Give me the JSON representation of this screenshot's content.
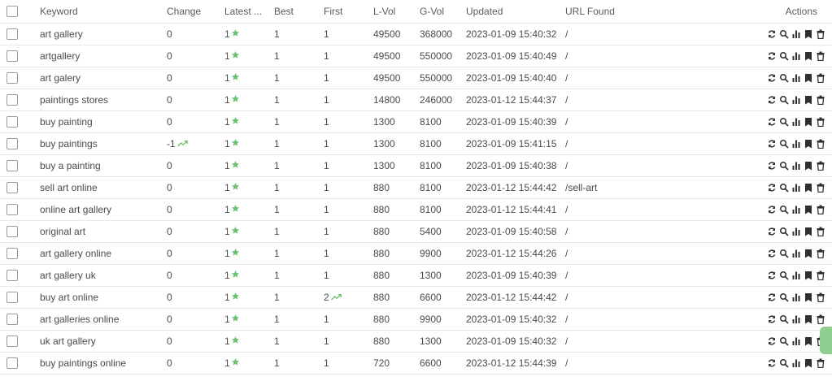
{
  "columns": {
    "keyword": "Keyword",
    "change": "Change",
    "latest": "Latest ...",
    "best": "Best",
    "first": "First",
    "lvol": "L-Vol",
    "gvol": "G-Vol",
    "updated": "Updated",
    "url": "URL Found",
    "actions": "Actions"
  },
  "colors": {
    "accent_green": "#6cc070",
    "icon_dark": "#2f2f2f"
  },
  "action_icons": [
    "refresh-icon",
    "search-icon",
    "bar-chart-icon",
    "bookmark-icon",
    "trash-icon"
  ],
  "rows": [
    {
      "keyword": "art gallery",
      "change": "0",
      "change_trend": false,
      "latest": "1",
      "best": "1",
      "first": "1",
      "first_trend": false,
      "lvol": "49500",
      "gvol": "368000",
      "updated": "2023-01-09 15:40:32",
      "url": "/"
    },
    {
      "keyword": "artgallery",
      "change": "0",
      "change_trend": false,
      "latest": "1",
      "best": "1",
      "first": "1",
      "first_trend": false,
      "lvol": "49500",
      "gvol": "550000",
      "updated": "2023-01-09 15:40:49",
      "url": "/"
    },
    {
      "keyword": "art galery",
      "change": "0",
      "change_trend": false,
      "latest": "1",
      "best": "1",
      "first": "1",
      "first_trend": false,
      "lvol": "49500",
      "gvol": "550000",
      "updated": "2023-01-09 15:40:40",
      "url": "/"
    },
    {
      "keyword": "paintings stores",
      "change": "0",
      "change_trend": false,
      "latest": "1",
      "best": "1",
      "first": "1",
      "first_trend": false,
      "lvol": "14800",
      "gvol": "246000",
      "updated": "2023-01-12 15:44:37",
      "url": "/"
    },
    {
      "keyword": "buy painting",
      "change": "0",
      "change_trend": false,
      "latest": "1",
      "best": "1",
      "first": "1",
      "first_trend": false,
      "lvol": "1300",
      "gvol": "8100",
      "updated": "2023-01-09 15:40:39",
      "url": "/"
    },
    {
      "keyword": "buy paintings",
      "change": "-1",
      "change_trend": true,
      "latest": "1",
      "best": "1",
      "first": "1",
      "first_trend": false,
      "lvol": "1300",
      "gvol": "8100",
      "updated": "2023-01-09 15:41:15",
      "url": "/"
    },
    {
      "keyword": "buy a painting",
      "change": "0",
      "change_trend": false,
      "latest": "1",
      "best": "1",
      "first": "1",
      "first_trend": false,
      "lvol": "1300",
      "gvol": "8100",
      "updated": "2023-01-09 15:40:38",
      "url": "/"
    },
    {
      "keyword": "sell art online",
      "change": "0",
      "change_trend": false,
      "latest": "1",
      "best": "1",
      "first": "1",
      "first_trend": false,
      "lvol": "880",
      "gvol": "8100",
      "updated": "2023-01-12 15:44:42",
      "url": "/sell-art"
    },
    {
      "keyword": "online art gallery",
      "change": "0",
      "change_trend": false,
      "latest": "1",
      "best": "1",
      "first": "1",
      "first_trend": false,
      "lvol": "880",
      "gvol": "8100",
      "updated": "2023-01-12 15:44:41",
      "url": "/"
    },
    {
      "keyword": "original art",
      "change": "0",
      "change_trend": false,
      "latest": "1",
      "best": "1",
      "first": "1",
      "first_trend": false,
      "lvol": "880",
      "gvol": "5400",
      "updated": "2023-01-09 15:40:58",
      "url": "/"
    },
    {
      "keyword": "art gallery online",
      "change": "0",
      "change_trend": false,
      "latest": "1",
      "best": "1",
      "first": "1",
      "first_trend": false,
      "lvol": "880",
      "gvol": "9900",
      "updated": "2023-01-12 15:44:26",
      "url": "/"
    },
    {
      "keyword": "art gallery uk",
      "change": "0",
      "change_trend": false,
      "latest": "1",
      "best": "1",
      "first": "1",
      "first_trend": false,
      "lvol": "880",
      "gvol": "1300",
      "updated": "2023-01-09 15:40:39",
      "url": "/"
    },
    {
      "keyword": "buy art online",
      "change": "0",
      "change_trend": false,
      "latest": "1",
      "best": "1",
      "first": "2",
      "first_trend": true,
      "lvol": "880",
      "gvol": "6600",
      "updated": "2023-01-12 15:44:42",
      "url": "/"
    },
    {
      "keyword": "art galleries online",
      "change": "0",
      "change_trend": false,
      "latest": "1",
      "best": "1",
      "first": "1",
      "first_trend": false,
      "lvol": "880",
      "gvol": "9900",
      "updated": "2023-01-09 15:40:32",
      "url": "/"
    },
    {
      "keyword": "uk art gallery",
      "change": "0",
      "change_trend": false,
      "latest": "1",
      "best": "1",
      "first": "1",
      "first_trend": false,
      "lvol": "880",
      "gvol": "1300",
      "updated": "2023-01-09 15:40:32",
      "url": "/"
    },
    {
      "keyword": "buy paintings online",
      "change": "0",
      "change_trend": false,
      "latest": "1",
      "best": "1",
      "first": "1",
      "first_trend": false,
      "lvol": "720",
      "gvol": "6600",
      "updated": "2023-01-12 15:44:39",
      "url": "/"
    }
  ]
}
